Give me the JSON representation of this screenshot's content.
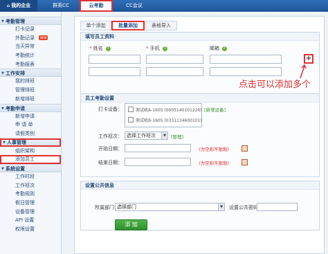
{
  "topnav": {
    "items": [
      "我的企业",
      "群英CC",
      "云考勤",
      "CC会议"
    ]
  },
  "sidebar": {
    "sections": [
      {
        "title": "考勤管理",
        "items": [
          "打卡记录",
          "外勤记录",
          "当天异常",
          "考勤统计",
          "考勤报表"
        ],
        "badge": "NEW"
      },
      {
        "title": "工作安排",
        "items": [
          "我的排班",
          "管理排班",
          "新增排班"
        ]
      },
      {
        "title": "考勤申请",
        "items": [
          "新增申请",
          "申 请 单",
          "请假类别"
        ]
      },
      {
        "title": "人事管理",
        "items": [
          "组织架构",
          "添加员工"
        ]
      },
      {
        "title": "系统设置",
        "items": [
          "工作时段",
          "工作班次",
          "考勤规则",
          "假日管理",
          "设备管理",
          "API 设置",
          "权限设置"
        ]
      }
    ]
  },
  "tabs": [
    "单个添加",
    "批量添加",
    "表格导入"
  ],
  "employee_panel": {
    "title": "填写员工资料",
    "fields": [
      {
        "label": "姓名",
        "required": true
      },
      {
        "label": "手机",
        "required": true
      },
      {
        "label": "邮箱",
        "required": false
      }
    ],
    "add_button": "+",
    "annotation": "点击可以添加多个"
  },
  "attendance_panel": {
    "title": "员工考勤设置",
    "device_label": "打卡设备：",
    "devices": [
      "测试机A-160S (0005140101226)",
      "测试机B-160S (0331134600101)"
    ],
    "new_device_link": "[新增设备]",
    "shift_label": "工作班次：",
    "shift_select": "选择工作班次",
    "manage_link": "[管理]",
    "start_label": "开始日期：",
    "start_hint": "(为空则不限制)",
    "end_label": "结束日期：",
    "end_hint": "(为空则不限制)"
  },
  "public_panel": {
    "title": "设置公共信息",
    "dept_label": "所属部门：",
    "dept_select": "选择部门",
    "password_label": "设置公共密码："
  },
  "submit_label": "添 加",
  "colors": {
    "topbar": "#2f6fb8",
    "highlight": "#e03030",
    "submit": "#3aa236",
    "link_green": "#3a8d2a"
  }
}
